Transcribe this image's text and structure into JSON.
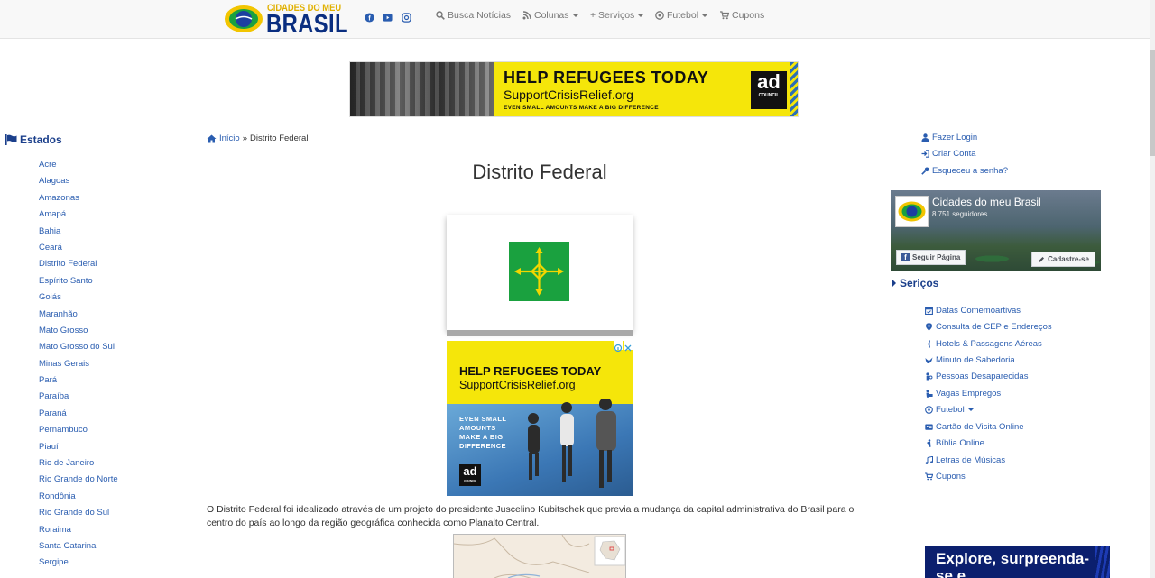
{
  "navbar": {
    "logo_small": "CIDADES DO MEU",
    "logo_big": "BRASIL",
    "social_icons": [
      "facebook-icon",
      "youtube-icon",
      "instagram-icon"
    ],
    "items": [
      {
        "label": "Busca Notícias",
        "icon": "search-icon",
        "dropdown": false
      },
      {
        "label": "Colunas",
        "icon": "rss-icon",
        "dropdown": true
      },
      {
        "label": "+ Serviços",
        "icon": "",
        "dropdown": true
      },
      {
        "label": "Futebol",
        "icon": "soccer-ball-icon",
        "dropdown": true
      },
      {
        "label": "Cupons",
        "icon": "cart-icon",
        "dropdown": false
      }
    ]
  },
  "top_ad": {
    "headline": "HELP REFUGEES TODAY",
    "site": "SupportCrisisRelief.org",
    "tagline": "EVEN SMALL AMOUNTS MAKE A BIG DIFFERENCE",
    "brand_big": "ad",
    "brand_small": "COUNCIL"
  },
  "states": {
    "title": "Estados",
    "items": [
      "Acre",
      "Alagoas",
      "Amazonas",
      "Amapá",
      "Bahia",
      "Ceará",
      "Distrito Federal",
      "Espírito Santo",
      "Goiás",
      "Maranhão",
      "Mato Grosso",
      "Mato Grosso do Sul",
      "Minas Gerais",
      "Pará",
      "Paraíba",
      "Paraná",
      "Pernambuco",
      "Piauí",
      "Rio de Janeiro",
      "Rio Grande do Norte",
      "Rondônia",
      "Rio Grande do Sul",
      "Roraima",
      "Santa Catarina",
      "Sergipe"
    ]
  },
  "breadcrumb": {
    "home": "Início",
    "separator": "»",
    "current": "Distrito Federal"
  },
  "main": {
    "title": "Distrito Federal",
    "paragraph": "O Distrito Federal foi idealizado através de um projeto do presidente Juscelino Kubitschek que previa a mudança da capital administrativa do Brasil para o centro do país ao longo da região geográfica conhecida como Planalto Central.",
    "flag_color": "#1aa13f",
    "flag_symbol_color": "#f2d600"
  },
  "square_ad": {
    "headline": "HELP REFUGEES TODAY",
    "site": "SupportCrisisRelief.org",
    "tagline": "EVEN SMALL AMOUNTS MAKE A BIG DIFFERENCE",
    "brand_big": "ad",
    "brand_small": "COUNCIL"
  },
  "auth": {
    "items": [
      {
        "label": "Fazer Login",
        "icon": "user-icon"
      },
      {
        "label": "Criar Conta",
        "icon": "sign-in-icon"
      },
      {
        "label": "Esqueceu a senha?",
        "icon": "key-icon"
      }
    ]
  },
  "facebook": {
    "page_name": "Cidades do meu Brasil",
    "followers": "8.751 seguidores",
    "follow_label": "Seguir Página",
    "signup_label": "Cadastre-se"
  },
  "services": {
    "title": "Seriços",
    "items": [
      {
        "label": "Datas Comemoartivas",
        "icon": "calendar-icon",
        "dropdown": false
      },
      {
        "label": "Consulta de CEP e Endereços",
        "icon": "map-marker-icon",
        "dropdown": false
      },
      {
        "label": "Hotels & Passagens Aéreas",
        "icon": "plane-icon",
        "dropdown": false
      },
      {
        "label": "Minuto de Sabedoria",
        "icon": "bird-icon",
        "dropdown": false
      },
      {
        "label": "Pessoas Desaparecidas",
        "icon": "person-search-icon",
        "dropdown": false
      },
      {
        "label": "Vagas Empregos",
        "icon": "briefcase-person-icon",
        "dropdown": false
      },
      {
        "label": "Futebol",
        "icon": "soccer-ball-icon",
        "dropdown": true
      },
      {
        "label": "Cartão de Visita Online",
        "icon": "id-card-icon",
        "dropdown": false
      },
      {
        "label": "Bíblia Online",
        "icon": "praying-icon",
        "dropdown": false
      },
      {
        "label": "Letras de Músicas",
        "icon": "music-icon",
        "dropdown": false
      },
      {
        "label": "Cupons",
        "icon": "cart-icon",
        "dropdown": false
      }
    ]
  },
  "explore_ad": {
    "text": "Explore, surpreenda-se e"
  }
}
